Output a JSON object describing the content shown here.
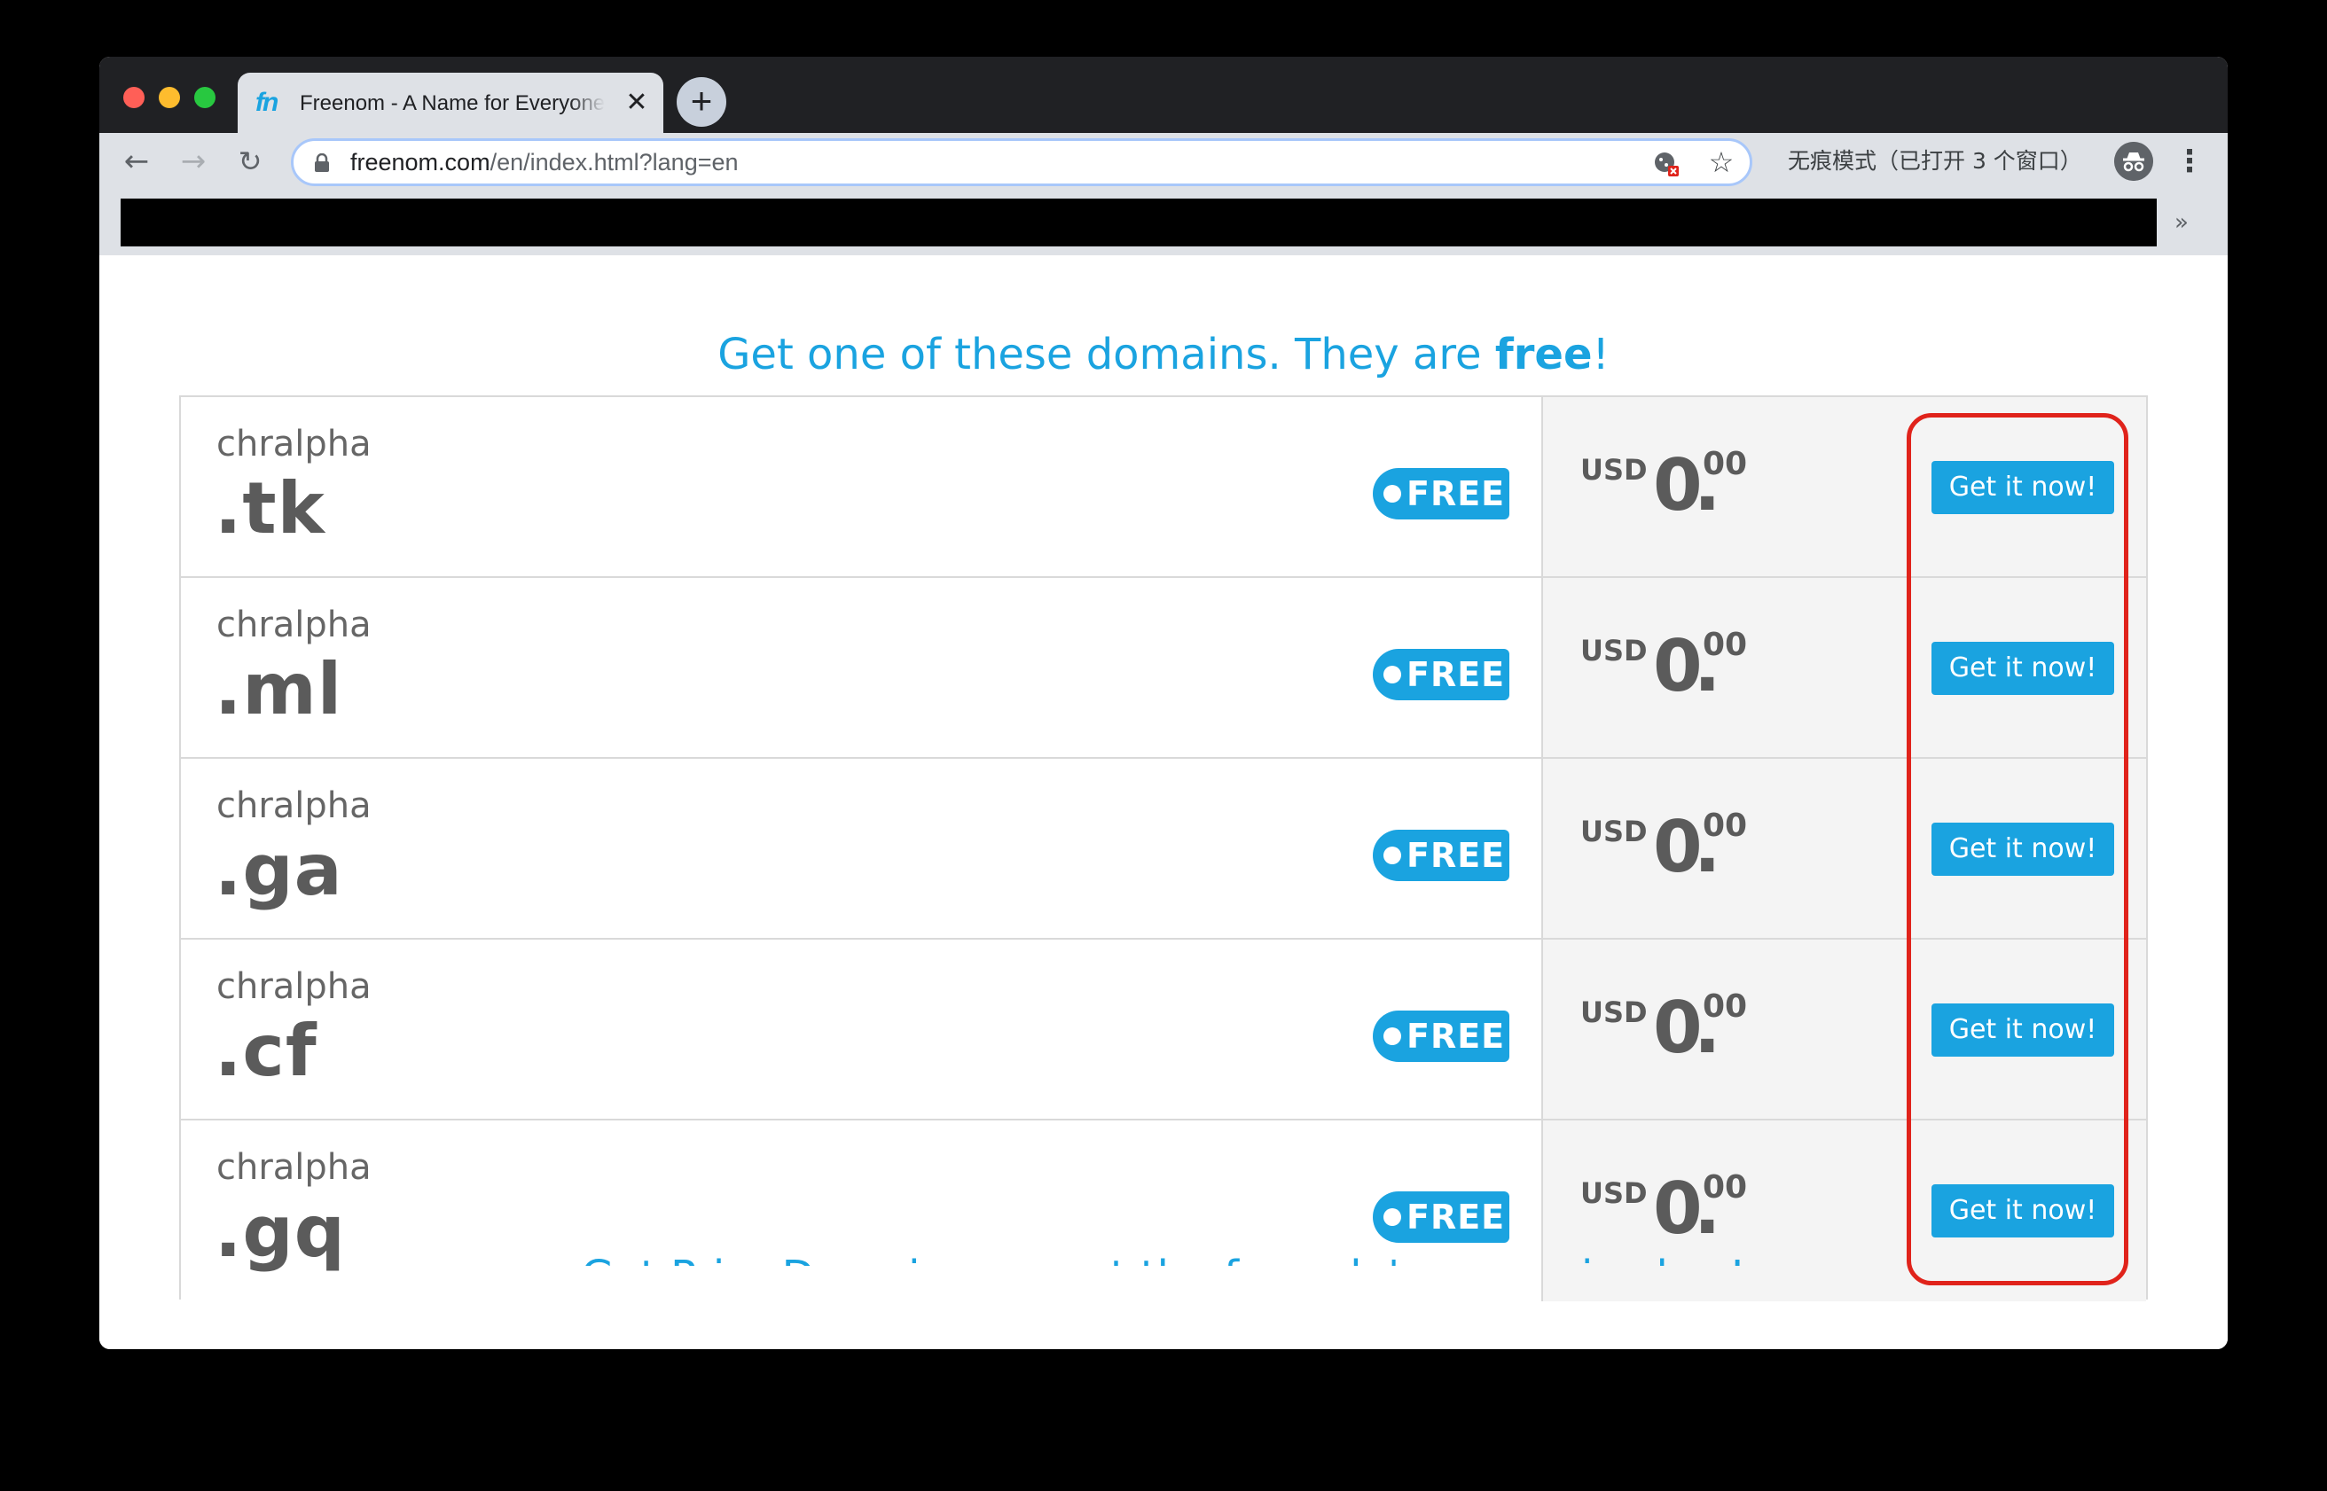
{
  "browser": {
    "tab": {
      "favicon": "fn",
      "title": "Freenom - A Name for Everyone",
      "close": "✕"
    },
    "new_tab": "+",
    "nav": {
      "back": "←",
      "forward": "→",
      "reload": "↻"
    },
    "url": {
      "host": "freenom.com",
      "path": "/en/index.html?lang=en"
    },
    "star": "☆",
    "incognito_label": "无痕模式（已打开 3 个窗口）",
    "menu": "⋮",
    "bookmarks_more": "»"
  },
  "page": {
    "heading_pre": "Get one of these domains. They are ",
    "heading_bold": "free",
    "heading_post": "!",
    "footer_heading": "Get Prior Domains now at the formula's own price low!"
  },
  "domains": [
    {
      "name": "chralpha",
      "tld": ".tk",
      "badge": "FREE",
      "currency": "USD",
      "price_int": "0",
      "price_dot": ".",
      "price_dec": "00",
      "button": "Get it now!"
    },
    {
      "name": "chralpha",
      "tld": ".ml",
      "badge": "FREE",
      "currency": "USD",
      "price_int": "0",
      "price_dot": ".",
      "price_dec": "00",
      "button": "Get it now!"
    },
    {
      "name": "chralpha",
      "tld": ".ga",
      "badge": "FREE",
      "currency": "USD",
      "price_int": "0",
      "price_dot": ".",
      "price_dec": "00",
      "button": "Get it now!"
    },
    {
      "name": "chralpha",
      "tld": ".cf",
      "badge": "FREE",
      "currency": "USD",
      "price_int": "0",
      "price_dot": ".",
      "price_dec": "00",
      "button": "Get it now!"
    },
    {
      "name": "chralpha",
      "tld": ".gq",
      "badge": "FREE",
      "currency": "USD",
      "price_int": "0",
      "price_dot": ".",
      "price_dec": "00",
      "button": "Get it now!"
    }
  ],
  "colors": {
    "accent": "#1aa3e0",
    "highlight": "#e0231b",
    "text": "#5b5b5b"
  }
}
